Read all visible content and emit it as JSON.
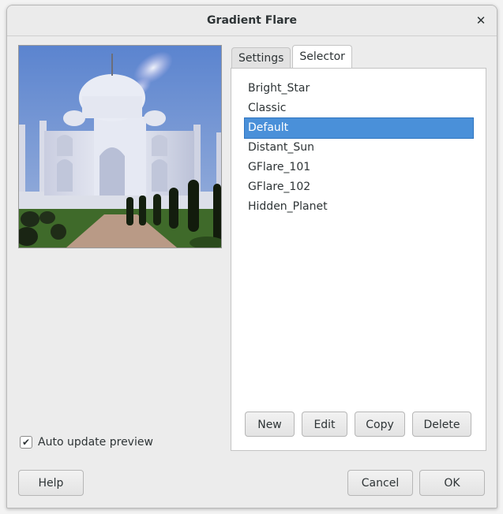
{
  "window": {
    "title": "Gradient Flare",
    "close_glyph": "✕"
  },
  "preview": {
    "image": "taj-mahal-with-flare-preview",
    "auto_update_label": "Auto update preview",
    "auto_update_checked": true,
    "check_glyph": "✔"
  },
  "tabs": [
    {
      "label": "Settings",
      "active": false
    },
    {
      "label": "Selector",
      "active": true
    }
  ],
  "selector": {
    "items": [
      {
        "label": "Bright_Star",
        "selected": false
      },
      {
        "label": "Classic",
        "selected": false
      },
      {
        "label": "Default",
        "selected": true
      },
      {
        "label": "Distant_Sun",
        "selected": false
      },
      {
        "label": "GFlare_101",
        "selected": false
      },
      {
        "label": "GFlare_102",
        "selected": false
      },
      {
        "label": "Hidden_Planet",
        "selected": false
      }
    ],
    "buttons": {
      "new": "New",
      "edit": "Edit",
      "copy": "Copy",
      "delete": "Delete"
    }
  },
  "dialog_buttons": {
    "help": "Help",
    "cancel": "Cancel",
    "ok": "OK"
  },
  "colors": {
    "selection": "#4a90d9",
    "sky": "#6f93d6"
  }
}
